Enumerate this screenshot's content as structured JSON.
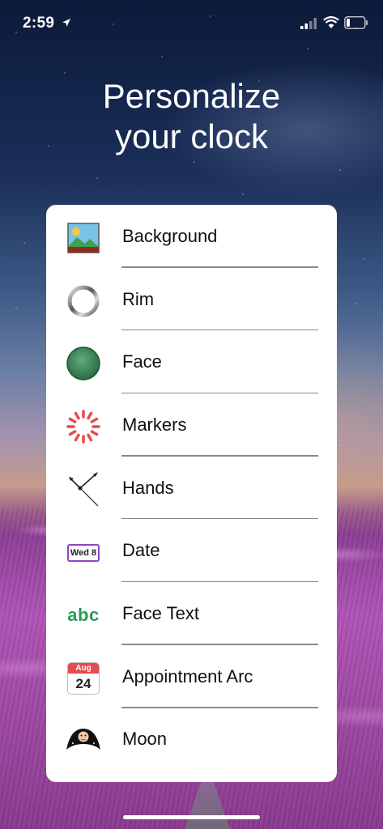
{
  "status_bar": {
    "time": "2:59"
  },
  "title": {
    "line1": "Personalize",
    "line2": "your clock"
  },
  "menu": {
    "items": [
      {
        "label": "Background",
        "icon": "picture-icon"
      },
      {
        "label": "Rim",
        "icon": "ring-icon"
      },
      {
        "label": "Face",
        "icon": "green-disc-icon"
      },
      {
        "label": "Markers",
        "icon": "markers-icon"
      },
      {
        "label": "Hands",
        "icon": "clock-hands-icon"
      },
      {
        "label": "Date",
        "icon": "date-badge-icon",
        "badge": "Wed 8"
      },
      {
        "label": "Face Text",
        "icon": "abc-text-icon",
        "icon_text": "abc"
      },
      {
        "label": "Appointment Arc",
        "icon": "calendar-icon",
        "month": "Aug",
        "day": "24"
      },
      {
        "label": "Moon",
        "icon": "moon-icon"
      }
    ]
  },
  "colors": {
    "accent_green": "#2a9a55",
    "marker_red": "#e84b4b",
    "date_border": "#8e44c6"
  }
}
